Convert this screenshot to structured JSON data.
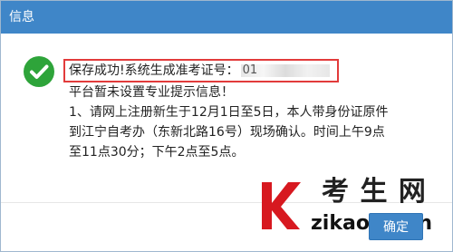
{
  "dialog": {
    "title": "信息",
    "status_icon": "check-circle-icon",
    "success_prefix": "保存成功!系统生成准考证号：",
    "success_code": "01",
    "message_lines": [
      "平台暂未设置专业提示信息！",
      "1、请网上注册新生于12月1日至5日，本人带身份证原件",
      "到江宁自考办（东新北路16号）现场确认。时间上午9点",
      "至11点30分；下午2点至5点。"
    ],
    "confirm_label": "确定"
  },
  "watermark": {
    "logo": "k-logo-mark",
    "title": "考 生 网",
    "url": "zikaosw.cn"
  },
  "colors": {
    "titlebar": "#3f86c8",
    "success_green": "#2ea43a",
    "highlight_red": "#e23b3b",
    "watermark_red": "#d71920"
  }
}
